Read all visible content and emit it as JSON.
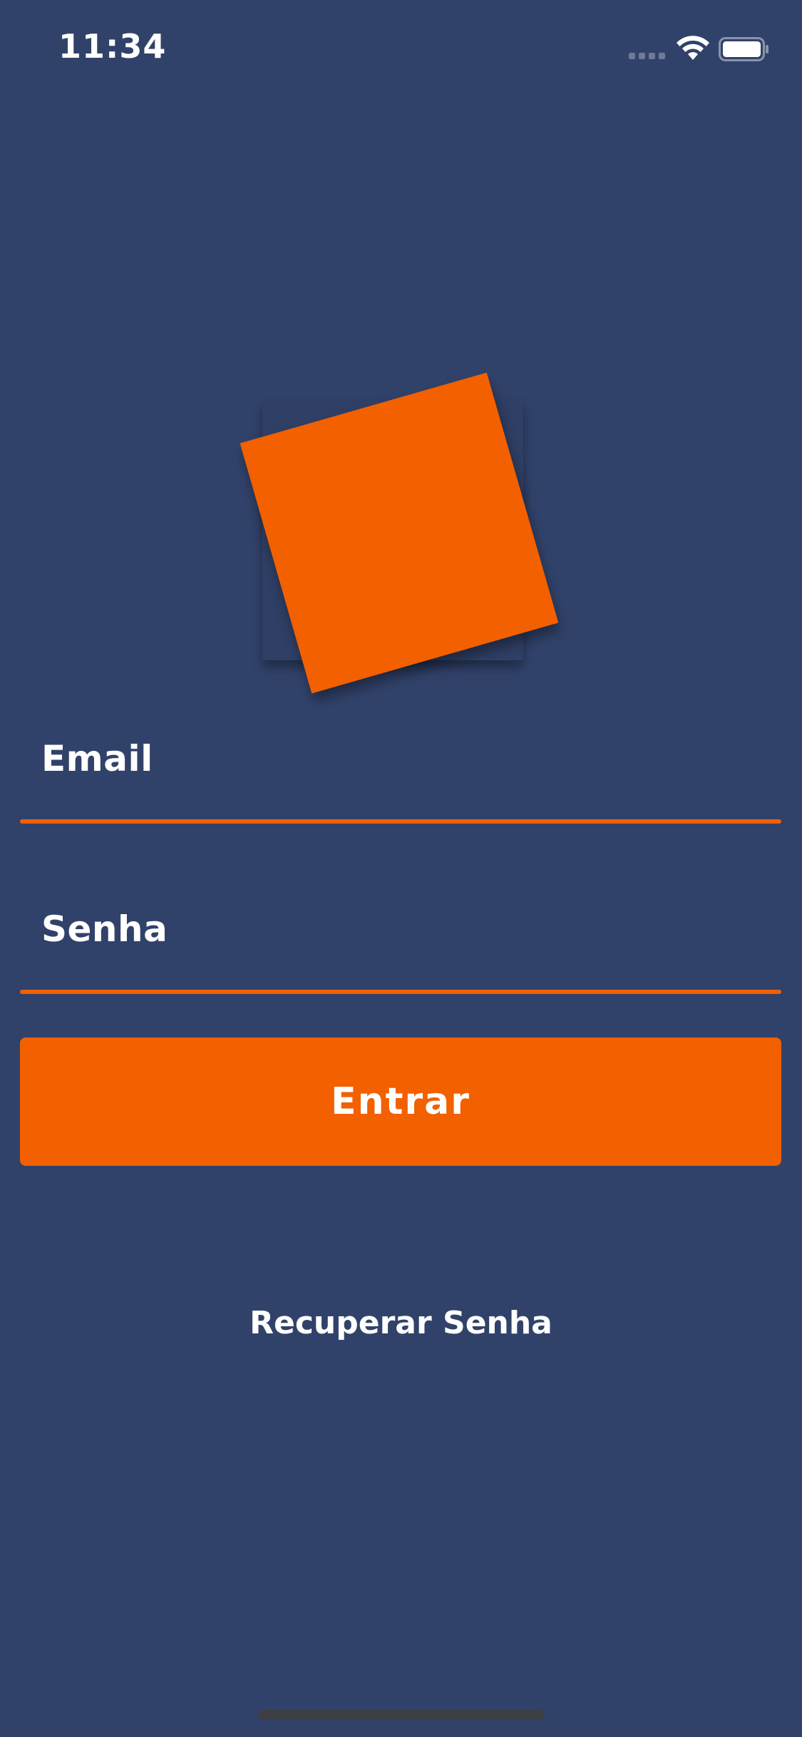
{
  "status_bar": {
    "time": "11:34",
    "signal_icon": "signal-dots-icon",
    "wifi_icon": "wifi-icon",
    "battery_icon": "battery-icon"
  },
  "logo": {
    "icon": "app-logo-icon",
    "color": "#f26000"
  },
  "form": {
    "email_label": "Email",
    "email_value": "",
    "password_label": "Senha",
    "password_value": "",
    "submit_label": "Entrar",
    "recover_label": "Recuperar Senha"
  },
  "colors": {
    "background": "#31426a",
    "accent": "#f26000",
    "text": "#ffffff"
  }
}
